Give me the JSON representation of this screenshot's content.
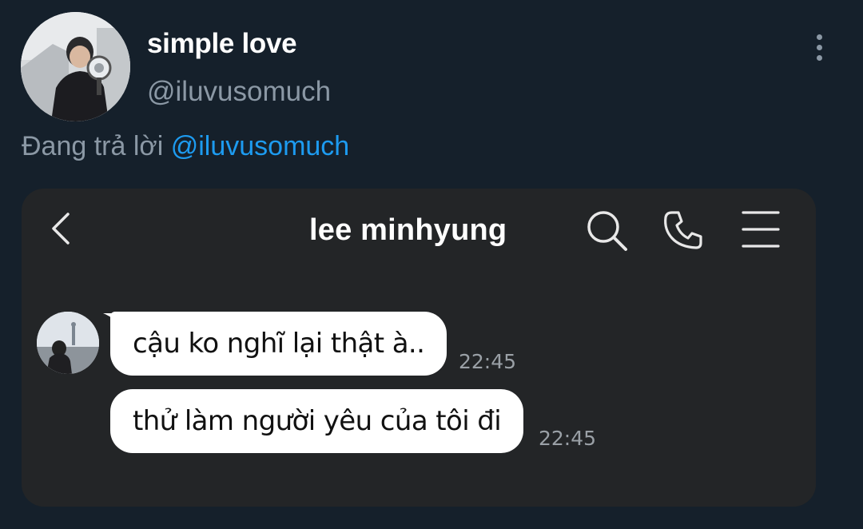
{
  "tweet": {
    "display_name": "simple love",
    "handle": "@iluvusomuch",
    "reply_prefix": "Đang trả lời",
    "reply_to": "@iluvusomuch",
    "more_icon": "more-vertical-icon"
  },
  "chat": {
    "title": "lee minhyung",
    "back_icon": "chevron-left-icon",
    "search_icon": "search-icon",
    "call_icon": "phone-icon",
    "menu_icon": "hamburger-menu-icon",
    "messages": [
      {
        "text": "cậu ko nghĩ lại thật à..",
        "time": "22:45"
      },
      {
        "text": "thử làm người yêu của tôi đi",
        "time": "22:45"
      }
    ]
  },
  "colors": {
    "background": "#15202b",
    "card": "#232527",
    "bubble": "#ffffff",
    "mention": "#1d9bf0",
    "muted": "#8b98a5"
  }
}
